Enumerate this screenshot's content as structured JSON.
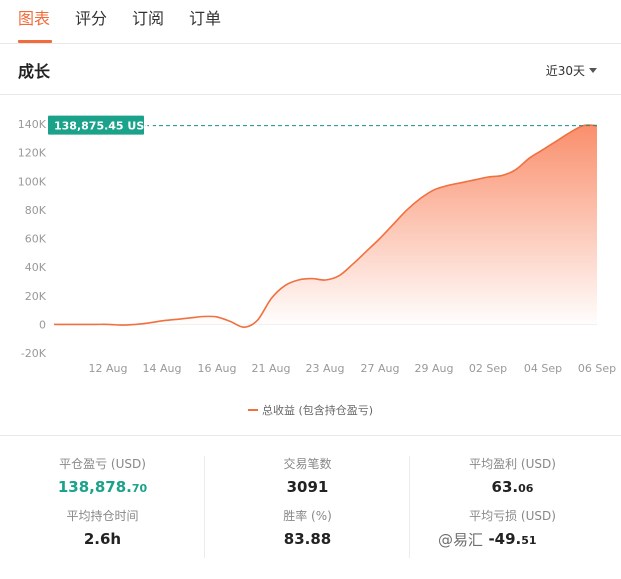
{
  "tabs": [
    "图表",
    "评分",
    "订阅",
    "订单"
  ],
  "section": {
    "title": "成长",
    "period": "近30天"
  },
  "chart_data": {
    "type": "area",
    "series": [
      {
        "name": "总收益 (包含持仓盈亏)"
      }
    ],
    "x_ticks": [
      "12 Aug",
      "14 Aug",
      "16 Aug",
      "21 Aug",
      "23 Aug",
      "27 Aug",
      "29 Aug",
      "02 Sep",
      "04 Sep",
      "06 Sep"
    ],
    "y_ticks": [
      "140K",
      "120K",
      "100K",
      "80K",
      "60K",
      "40K",
      "20K",
      "0",
      "-20K"
    ],
    "ylim": [
      -20000,
      140000
    ],
    "values": [
      0,
      0,
      0,
      0,
      0,
      -500,
      0,
      1000,
      2500,
      3500,
      4500,
      5500,
      5200,
      2000,
      -2000,
      3000,
      18000,
      27000,
      31000,
      32000,
      31000,
      34000,
      42000,
      51000,
      60000,
      70000,
      80000,
      88000,
      94000,
      97000,
      99000,
      101000,
      103000,
      104000,
      108000,
      116000,
      122000,
      128000,
      134000,
      138875.45,
      138875.45
    ],
    "max_label": "138,875.45 USD",
    "colors": {
      "line": "#f07040",
      "fill_top": "#f9825c",
      "fill_bottom": "#ffffff",
      "max_badge": "#1aa28a",
      "ref_line": "#1a8f8a"
    }
  },
  "stats": [
    [
      {
        "label": "平仓盈亏 (USD)",
        "value": "138,878.",
        "decimal": "70",
        "green": true
      },
      {
        "label": "平均持仓时间",
        "value": "2.6h",
        "decimal": ""
      }
    ],
    [
      {
        "label": "交易笔数",
        "value": "3091",
        "decimal": ""
      },
      {
        "label": "胜率 (%)",
        "value": "83.88",
        "decimal": ""
      }
    ],
    [
      {
        "label": "平均盈利 (USD)",
        "value": "63.",
        "decimal": "06"
      },
      {
        "label": "平均亏损 (USD)",
        "value": "-49.",
        "decimal": "51"
      }
    ]
  ],
  "watermark": "@易汇"
}
